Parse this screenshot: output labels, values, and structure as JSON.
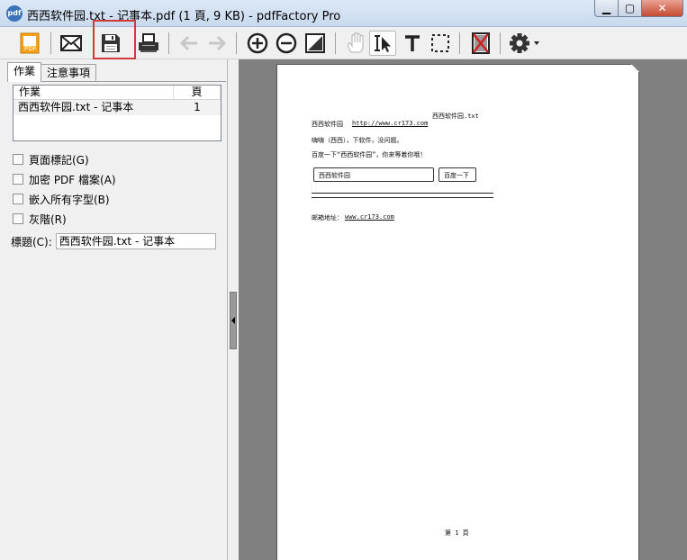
{
  "window": {
    "title": "西西软件园.txt - 记事本.pdf (1 頁, 9 KB) - pdfFactory Pro",
    "app_icon_text": "pdf",
    "minimize_glyph": "▁",
    "maximize_glyph": "▢",
    "close_glyph": "✕"
  },
  "toolbar": {
    "pdf_icon_text": "PDF"
  },
  "left_panel": {
    "tabs": [
      {
        "label": "作業"
      },
      {
        "label": "注意事項"
      }
    ],
    "job_list": {
      "columns": {
        "name": "作業",
        "pages": "頁"
      },
      "rows": [
        {
          "name": "西西软件园.txt - 记事本",
          "pages": "1"
        }
      ]
    },
    "options": [
      {
        "label": "頁面標記(G)",
        "checked": false
      },
      {
        "label": "加密 PDF 檔案(A)",
        "checked": false
      },
      {
        "label": "嵌入所有字型(B)",
        "checked": false
      },
      {
        "label": "灰階(R)",
        "checked": false
      }
    ],
    "title_field": {
      "label": "標題(C):",
      "value": "西西软件园.txt - 记事本"
    }
  },
  "preview": {
    "header": "西西软件园.txt",
    "line1_text": "西西软件园",
    "line1_link": "http://www.cr173.com",
    "line2": "嗨嗨（西西），下软件，没问题。",
    "line3": "百度一下“西西软件园”，你来等着你哦！",
    "search_input": "西西软件园",
    "search_button": "百度一下",
    "contact_label": "邮箱地址：",
    "contact_link": "www.cr173.com",
    "footer": "第 1 頁"
  },
  "colors": {
    "highlight": "#d23a3a",
    "preview_bg": "#808080"
  }
}
